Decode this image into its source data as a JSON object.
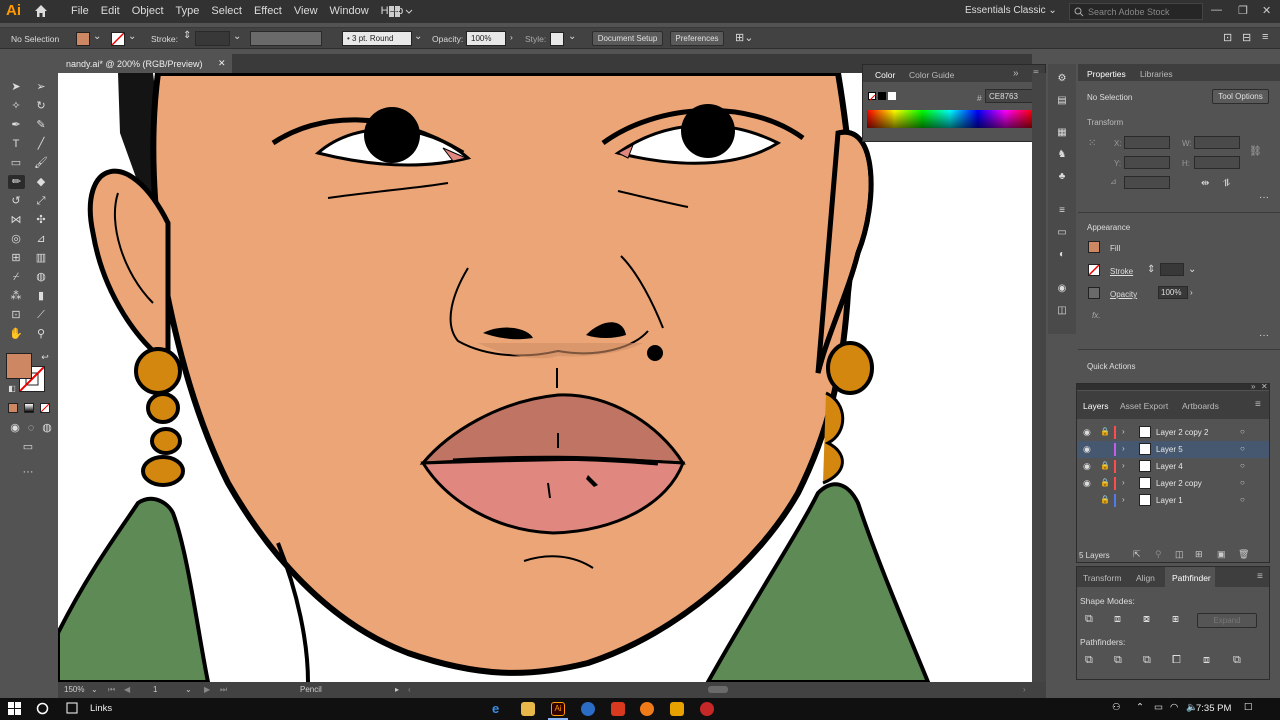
{
  "app": {
    "logo": "Ai",
    "workspace": "Essentials Classic",
    "search_placeholder": "Search Adobe Stock"
  },
  "menu": [
    "File",
    "Edit",
    "Object",
    "Type",
    "Select",
    "Effect",
    "View",
    "Window",
    "Help"
  ],
  "control_bar": {
    "selection": "No Selection",
    "stroke_label": "Stroke:",
    "brush": "3 pt. Round",
    "opacity_label": "Opacity:",
    "opacity_value": "100%",
    "style_label": "Style:",
    "document_setup": "Document Setup",
    "preferences": "Preferences"
  },
  "document_tab": {
    "title": "nandy.ai* @ 200% (RGB/Preview)"
  },
  "color_panel": {
    "tabs": [
      "Color",
      "Color Guide"
    ],
    "hex_label": "#",
    "hex_value": "CE8763"
  },
  "properties_panel": {
    "tabs": [
      "Properties",
      "Libraries"
    ],
    "selection": "No Selection",
    "tool_options": "Tool Options",
    "transform": "Transform",
    "x_label": "X:",
    "y_label": "Y:",
    "w_label": "W:",
    "h_label": "H:",
    "appearance": "Appearance",
    "fill": "Fill",
    "stroke": "Stroke",
    "opacity": "Opacity",
    "opacity_value": "100%",
    "fx": "fx.",
    "quick_actions": "Quick Actions"
  },
  "layers_panel": {
    "tabs": [
      "Layers",
      "Asset Export",
      "Artboards"
    ],
    "layers": [
      {
        "name": "Layer 2 copy 2",
        "color": "#ff4c4c",
        "visible": true,
        "locked": true,
        "selected": false
      },
      {
        "name": "Layer 5",
        "color": "#c35ee8",
        "visible": true,
        "locked": false,
        "selected": true
      },
      {
        "name": "Layer 4",
        "color": "#ff4c4c",
        "visible": true,
        "locked": true,
        "selected": false
      },
      {
        "name": "Layer 2 copy",
        "color": "#ff4c4c",
        "visible": true,
        "locked": true,
        "selected": false
      },
      {
        "name": "Layer 1",
        "color": "#4f7df0",
        "visible": false,
        "locked": true,
        "selected": false
      }
    ],
    "count": "5 Layers"
  },
  "pathfinder_panel": {
    "tabs": [
      "Transform",
      "Align",
      "Pathfinder"
    ],
    "shape_modes": "Shape Modes:",
    "pathfinders": "Pathfinders:",
    "expand": "Expand"
  },
  "status_bar": {
    "zoom": "150%",
    "artboard": "1",
    "tool": "Pencil"
  },
  "taskbar": {
    "links": "Links",
    "time": "7:35 PM"
  },
  "colors": {
    "skin": "#eba577",
    "lips_upper": "#c07464",
    "lips_lower": "#e0887f",
    "earring": "#d4870f",
    "shirt": "#5e8a55",
    "fill_swatch": "#ce8763",
    "accent_blue": "#46586f"
  }
}
